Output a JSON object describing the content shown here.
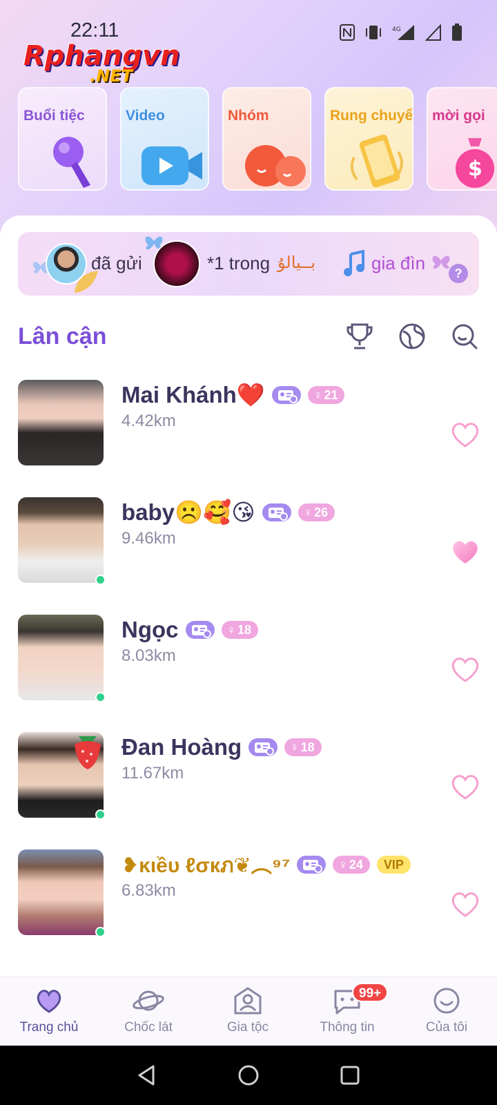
{
  "status_bar": {
    "time": "22:11",
    "network": "4G"
  },
  "watermark": {
    "main": "Rphangvn",
    "sub": ".NET"
  },
  "categories": [
    {
      "label": "Buổi tiệc",
      "icon": "microphone-icon"
    },
    {
      "label": "Video",
      "icon": "video-camera-icon"
    },
    {
      "label": "Nhóm",
      "icon": "chat-bubbles-icon"
    },
    {
      "label": "Rung chuyển",
      "icon": "shaking-phone-icon"
    },
    {
      "label": "mời gọi",
      "icon": "money-bag-icon"
    }
  ],
  "ticker": {
    "sent_text": "đã gửi",
    "gift_text": "*1 trong",
    "decor_text": "بــيالۇ",
    "group_text": "gia đìn",
    "help": "?"
  },
  "section": {
    "title": "Lân cận"
  },
  "users": [
    {
      "name": "Mai Khánh❤️",
      "age": "21",
      "distance": "4.42km",
      "online": false,
      "vip": "",
      "liked": false
    },
    {
      "name": "baby☹️🥰😘",
      "age": "26",
      "distance": "9.46km",
      "online": true,
      "vip": "",
      "liked": true
    },
    {
      "name": "Ngọc",
      "age": "18",
      "distance": "8.03km",
      "online": true,
      "vip": "",
      "liked": false
    },
    {
      "name": "Đan Hoàng",
      "age": "18",
      "distance": "11.67km",
      "online": true,
      "vip": "",
      "liked": false
    },
    {
      "name": "❥ĸιềυ ℓσкภ❦︵⁹⁷",
      "age": "24",
      "distance": "6.83km",
      "online": true,
      "vip": "VIP",
      "liked": false
    }
  ],
  "bottom_nav": [
    {
      "label": "Trang chủ",
      "icon": "heart-planet-icon",
      "active": true
    },
    {
      "label": "Chốc lát",
      "icon": "planet-icon",
      "active": false
    },
    {
      "label": "Gia tộc",
      "icon": "family-icon",
      "active": false
    },
    {
      "label": "Thông tin",
      "icon": "message-icon",
      "active": false,
      "badge": "99+"
    },
    {
      "label": "Của tôi",
      "icon": "smile-icon",
      "active": false
    }
  ],
  "colors": {
    "accent": "#7b4fd8",
    "name_text": "#3a355e",
    "age_badge": "#f0a6df",
    "id_badge": "#a58af0",
    "online": "#2fd08c",
    "notification": "#f14545"
  }
}
